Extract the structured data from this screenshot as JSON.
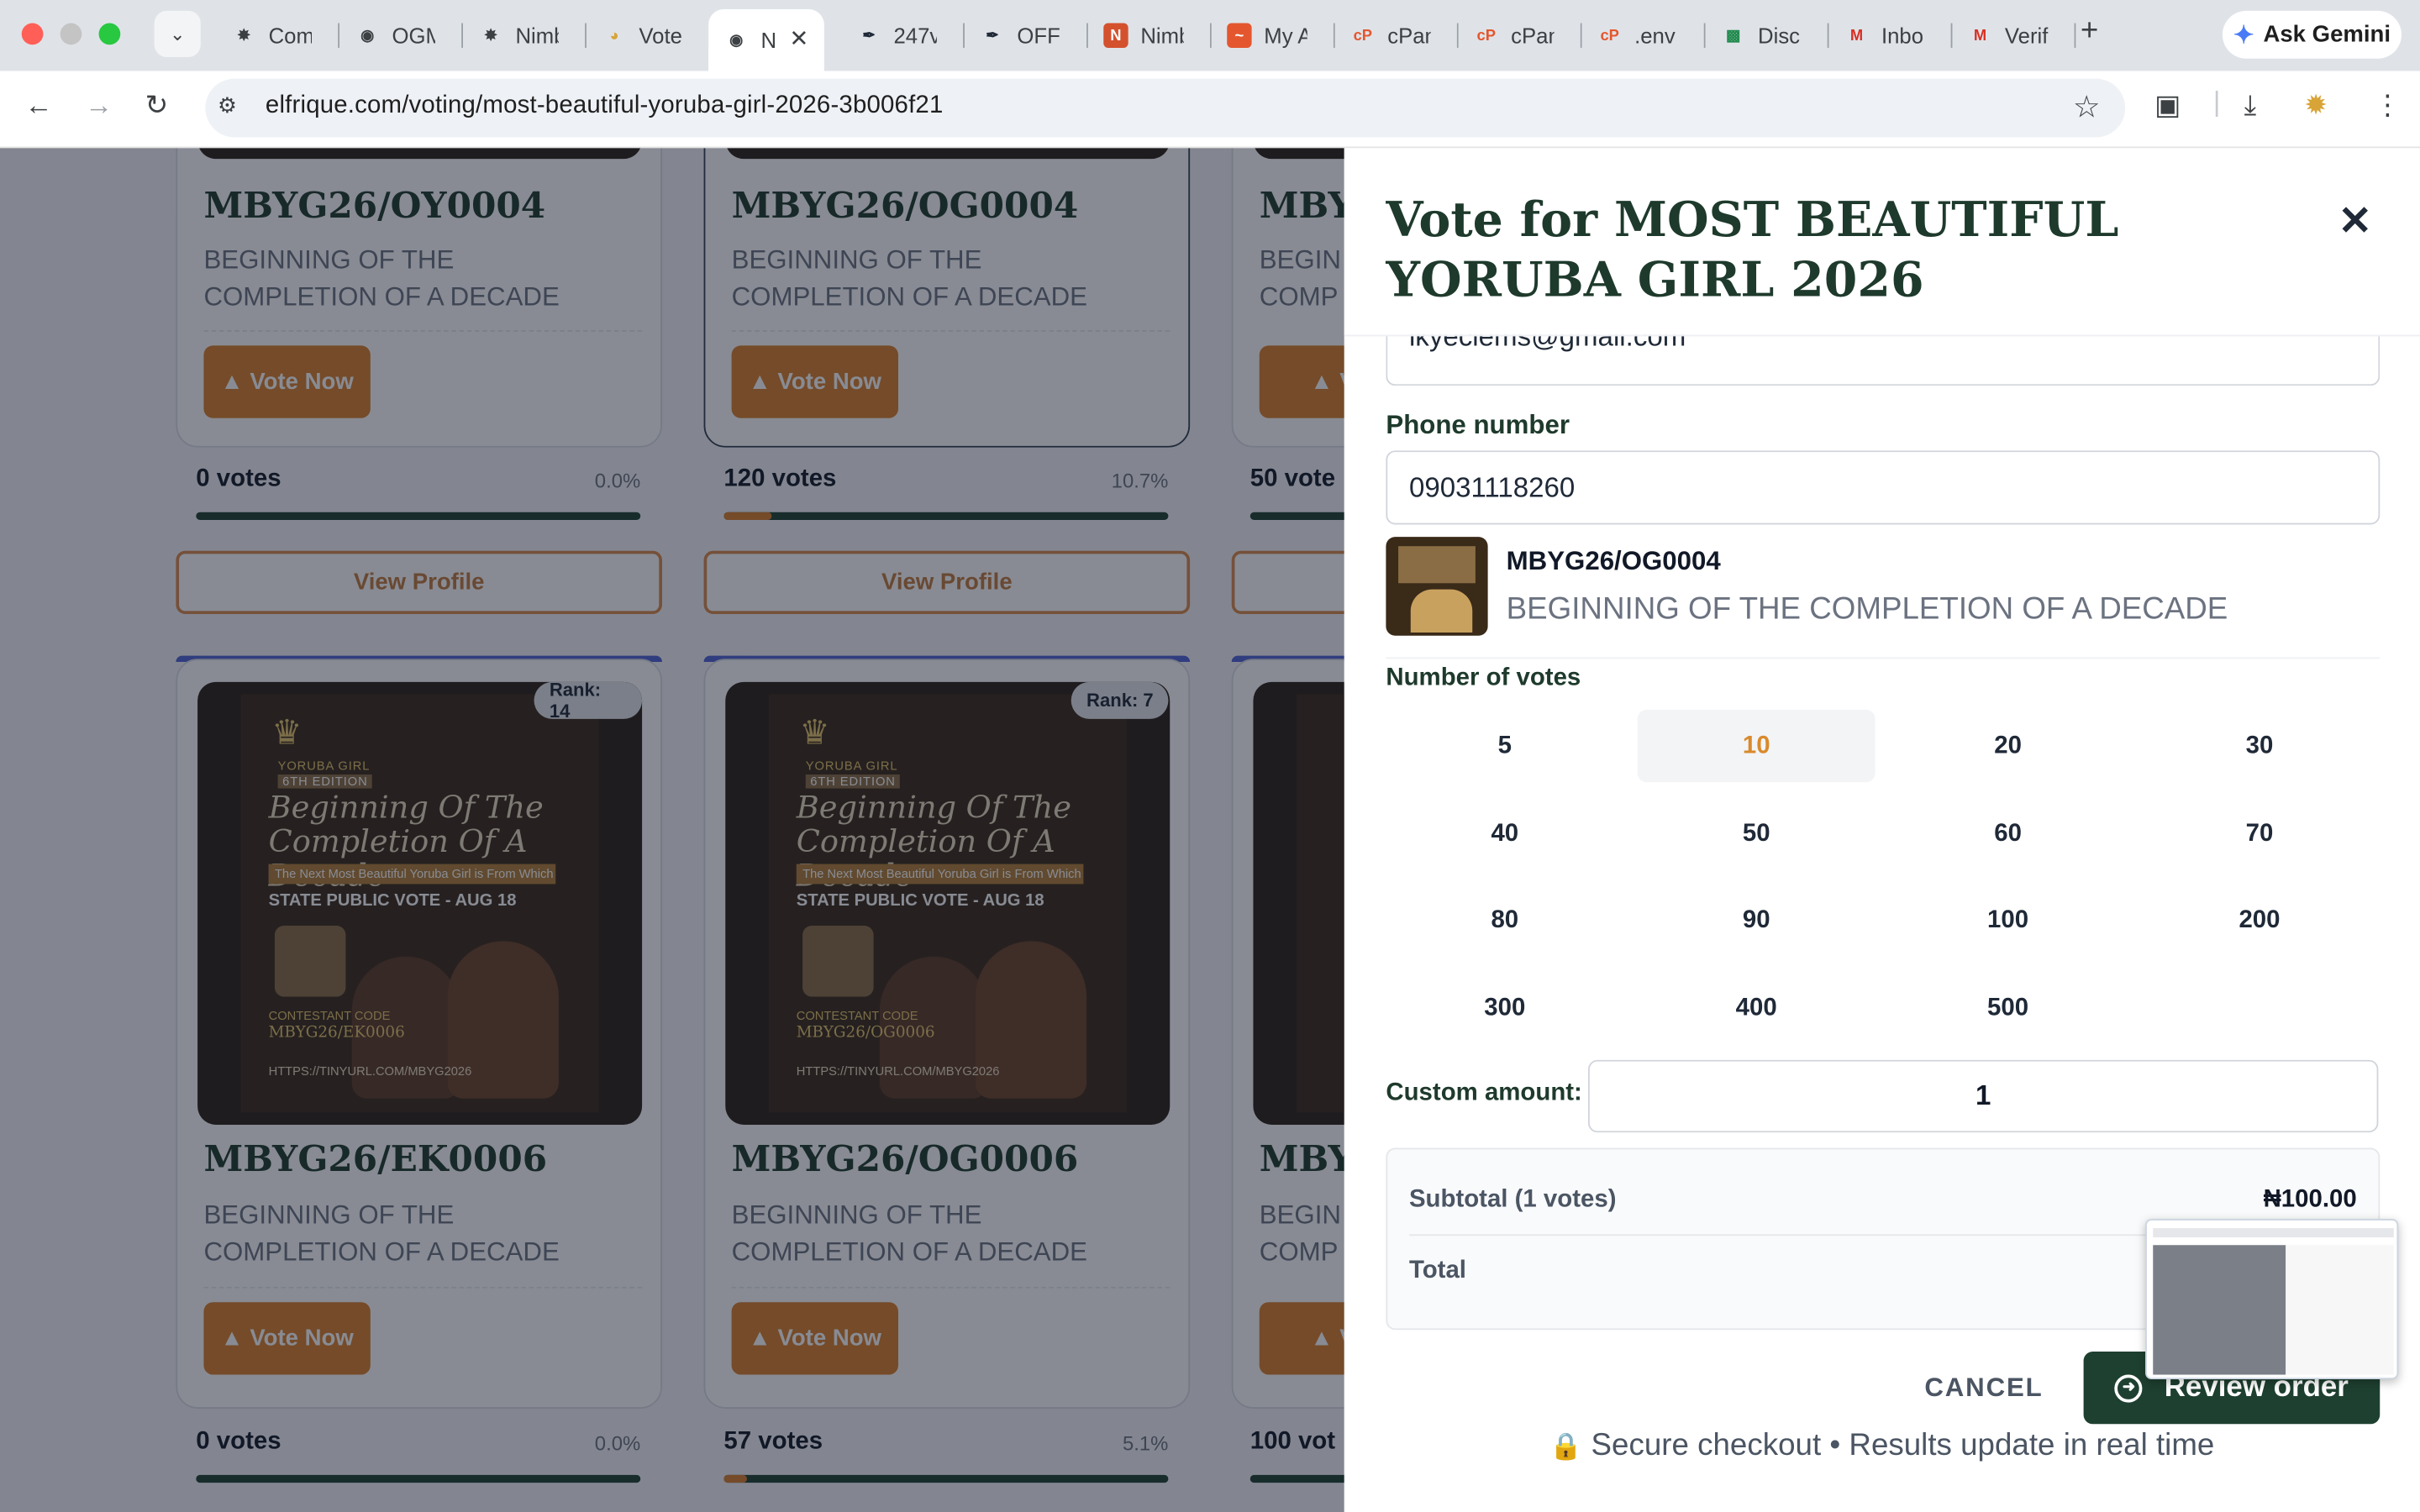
{
  "browser": {
    "tabs": [
      {
        "title": "Com",
        "icon": "chatgpt-icon"
      },
      {
        "title": "OGM",
        "icon": "globe-icon"
      },
      {
        "title": "Nimb",
        "icon": "chatgpt-icon"
      },
      {
        "title": "Vote",
        "icon": "vote-icon"
      },
      {
        "title": "N",
        "icon": "globe-icon",
        "active": true
      },
      {
        "title": "247v",
        "icon": "feather-icon"
      },
      {
        "title": "OFFI",
        "icon": "feather-icon"
      },
      {
        "title": "Nimb",
        "icon": "nbtv-icon"
      },
      {
        "title": "My A",
        "icon": "brand-icon"
      },
      {
        "title": "cPan",
        "icon": "cpanel-icon"
      },
      {
        "title": "cPan",
        "icon": "cpanel-icon"
      },
      {
        "title": ".env",
        "icon": "cpanel-icon"
      },
      {
        "title": "Disc",
        "icon": "doc-icon"
      },
      {
        "title": "Inbo",
        "icon": "gmail-icon"
      },
      {
        "title": "Verif",
        "icon": "gmail-icon"
      }
    ],
    "new_tab": "+",
    "gemini_label": "Ask Gemini",
    "url": "elfrique.com/voting/most-beautiful-yoruba-girl-2026-3b006f21"
  },
  "cards": [
    {
      "code": "MBYG26/OY0004",
      "desc": "BEGINNING OF THE COMPLETION OF A DECADE",
      "vote_label": "▲ Vote Now",
      "votes": "0 votes",
      "pct": "0.0%",
      "pct_value": 0.0,
      "profile_label": "View Profile"
    },
    {
      "code": "MBYG26/OG0004",
      "desc": "BEGINNING OF THE COMPLETION OF A DECADE",
      "vote_label": "▲ Vote Now",
      "votes": "120 votes",
      "pct": "10.7%",
      "pct_value": 10.7,
      "profile_label": "View Profile"
    },
    {
      "code": "MBYG26/EK0006",
      "desc": "BEGINNING OF THE COMPLETION OF A DECADE",
      "vote_label": "▲ Vote Now",
      "votes": "0 votes",
      "pct": "0.0%",
      "pct_value": 0.0,
      "rank": "Rank: 14"
    },
    {
      "code": "MBYG26/OG0006",
      "desc": "BEGINNING OF THE COMPLETION OF A DECADE",
      "vote_label": "▲ Vote Now",
      "votes": "57 votes",
      "pct": "5.1%",
      "pct_value": 5.1,
      "rank": "Rank: 7"
    }
  ],
  "partial_cards": {
    "code": "MBY",
    "desc_line1": "BEGIN",
    "desc_line2": "COMP",
    "vote_label": "▲ Vot",
    "votes_top": "50 vote",
    "votes_bottom": "100 vot"
  },
  "poster": {
    "brand": "YORUBA GIRL",
    "edition": "6TH EDITION",
    "title": "Beginning Of The Completion Of A Decade",
    "tagline": "The Next Most Beautiful Yoruba Girl is From Which State?",
    "vote_line": "STATE PUBLIC VOTE - AUG 18",
    "code_label": "CONTESTANT CODE",
    "link": "HTTPS://TINYURL.COM/MBYG2026"
  },
  "modal": {
    "title": "Vote for MOST BEAUTIFUL YORUBA GIRL 2026",
    "email_value": "ikyeclems@gmail.com",
    "phone_label": "Phone number",
    "phone_value": "09031118260",
    "candidate_code": "MBYG26/OG0004",
    "candidate_desc": "BEGINNING OF THE COMPLETION OF A DECADE",
    "votes_label": "Number of votes",
    "vote_options": [
      "5",
      "10",
      "20",
      "30",
      "40",
      "50",
      "60",
      "70",
      "80",
      "90",
      "100",
      "200",
      "300",
      "400",
      "500"
    ],
    "selected_option": "10",
    "custom_label": "Custom amount:",
    "custom_value": "1",
    "subtotal_label": "Subtotal (1 votes)",
    "subtotal_value": "₦100.00",
    "total_label": "Total",
    "cancel_label": "CANCEL",
    "review_label": "Review order",
    "secure_text": "Secure checkout • Results update in real time"
  },
  "colors": {
    "accent_orange": "#d97f2a",
    "dark_green": "#1e4030",
    "title_green": "#1e3a2c"
  }
}
